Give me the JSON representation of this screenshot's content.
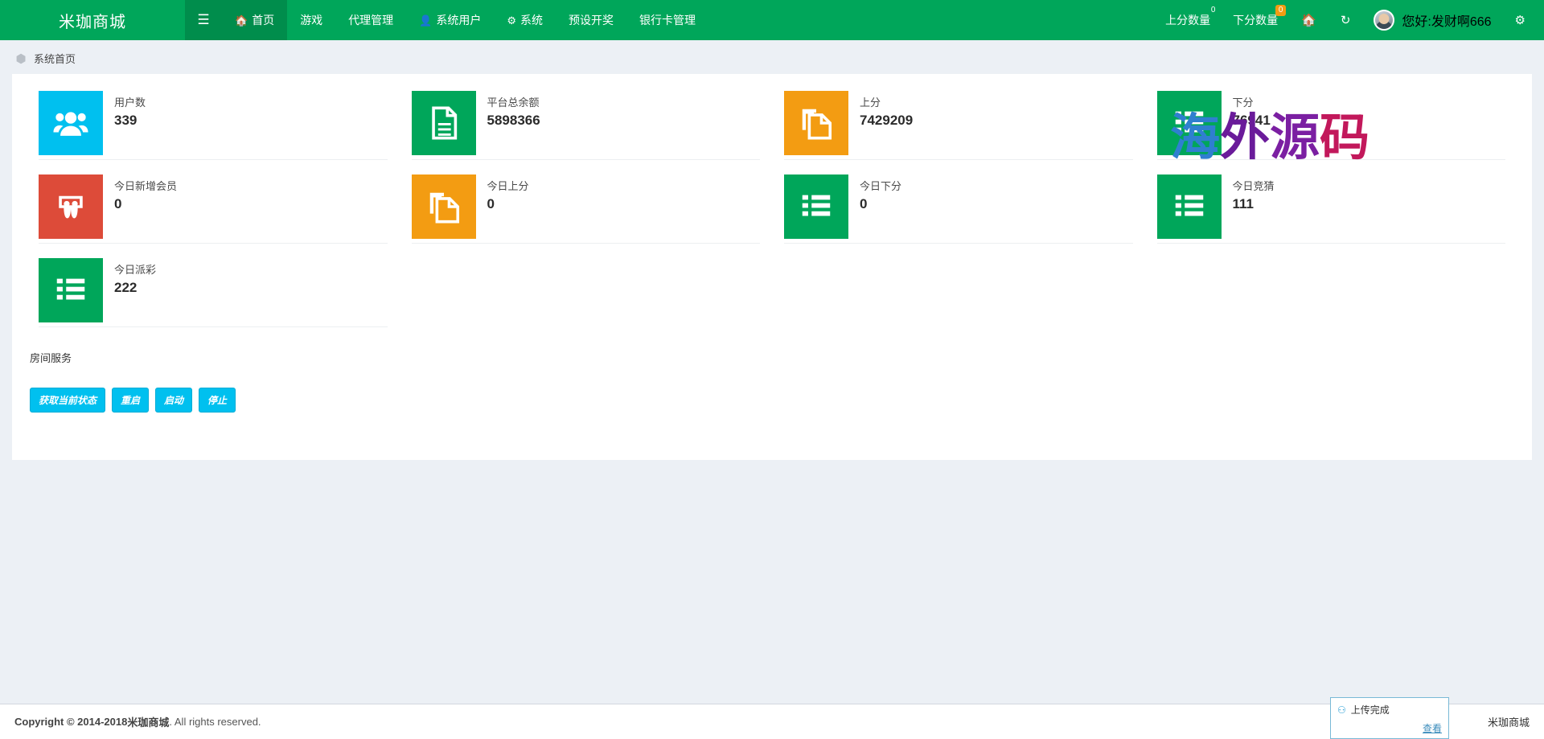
{
  "header": {
    "brand": "米珈商城",
    "toggle_icon": "hamburger-icon",
    "nav": [
      {
        "label": "首页",
        "icon": "home-icon",
        "active": true
      },
      {
        "label": "游戏",
        "icon": "",
        "active": false
      },
      {
        "label": "代理管理",
        "icon": "",
        "active": false
      },
      {
        "label": "系统用户",
        "icon": "user-icon",
        "active": false
      },
      {
        "label": "系统",
        "icon": "gear-icon",
        "active": false
      },
      {
        "label": "预设开奖",
        "icon": "",
        "active": false
      },
      {
        "label": "银行卡管理",
        "icon": "",
        "active": false
      }
    ],
    "right": {
      "up_count_label": "上分数量",
      "up_count_badge": "0",
      "down_count_label": "下分数量",
      "down_count_badge": "0",
      "home_icon": "home-icon",
      "refresh_icon": "refresh-icon",
      "greeting": "您好:发财啊666",
      "settings_icon": "gears-icon"
    }
  },
  "breadcrumb": {
    "icon": "dashboard-icon",
    "title": "系统首页"
  },
  "stats": [
    {
      "title": "用户数",
      "value": "339",
      "color": "#00c0ef",
      "icon": "users-icon"
    },
    {
      "title": "平台总余额",
      "value": "5898366",
      "color": "#00a65a",
      "icon": "file-text-icon"
    },
    {
      "title": "上分",
      "value": "7429209",
      "color": "#f39c12",
      "icon": "files-icon"
    },
    {
      "title": "下分",
      "value": "76941",
      "color": "#00a65a",
      "icon": "list-icon"
    },
    {
      "title": "今日新增会员",
      "value": "0",
      "color": "#dd4b39",
      "icon": "user-plus-icon"
    },
    {
      "title": "今日上分",
      "value": "0",
      "color": "#f39c12",
      "icon": "files-icon"
    },
    {
      "title": "今日下分",
      "value": "0",
      "color": "#00a65a",
      "icon": "list-icon"
    },
    {
      "title": "今日竞猜",
      "value": "111",
      "color": "#00a65a",
      "icon": "list-icon"
    },
    {
      "title": "今日派彩",
      "value": "222",
      "color": "#00a65a",
      "icon": "list-icon"
    }
  ],
  "service": {
    "label": "房间服务",
    "buttons": [
      {
        "label": "获取当前状态"
      },
      {
        "label": "重启"
      },
      {
        "label": "启动"
      },
      {
        "label": "停止"
      }
    ]
  },
  "watermark": {
    "c1": "海",
    "c2": "外",
    "c3": "源",
    "c4": "码"
  },
  "footer": {
    "copyright": "Copyright © 2014-2018 ",
    "company": "米珈商城",
    "rights": ". All rights reserved.",
    "brand": "米珈商城"
  },
  "toast": {
    "icon": "upload-done-icon",
    "message": "上传完成",
    "link": "查看"
  },
  "colors": {
    "brand_green": "#00a65a",
    "brand_green_dark": "#008d4c",
    "cyan": "#00c0ef",
    "orange": "#f39c12",
    "red": "#dd4b39",
    "page_bg": "#ecf0f5"
  }
}
